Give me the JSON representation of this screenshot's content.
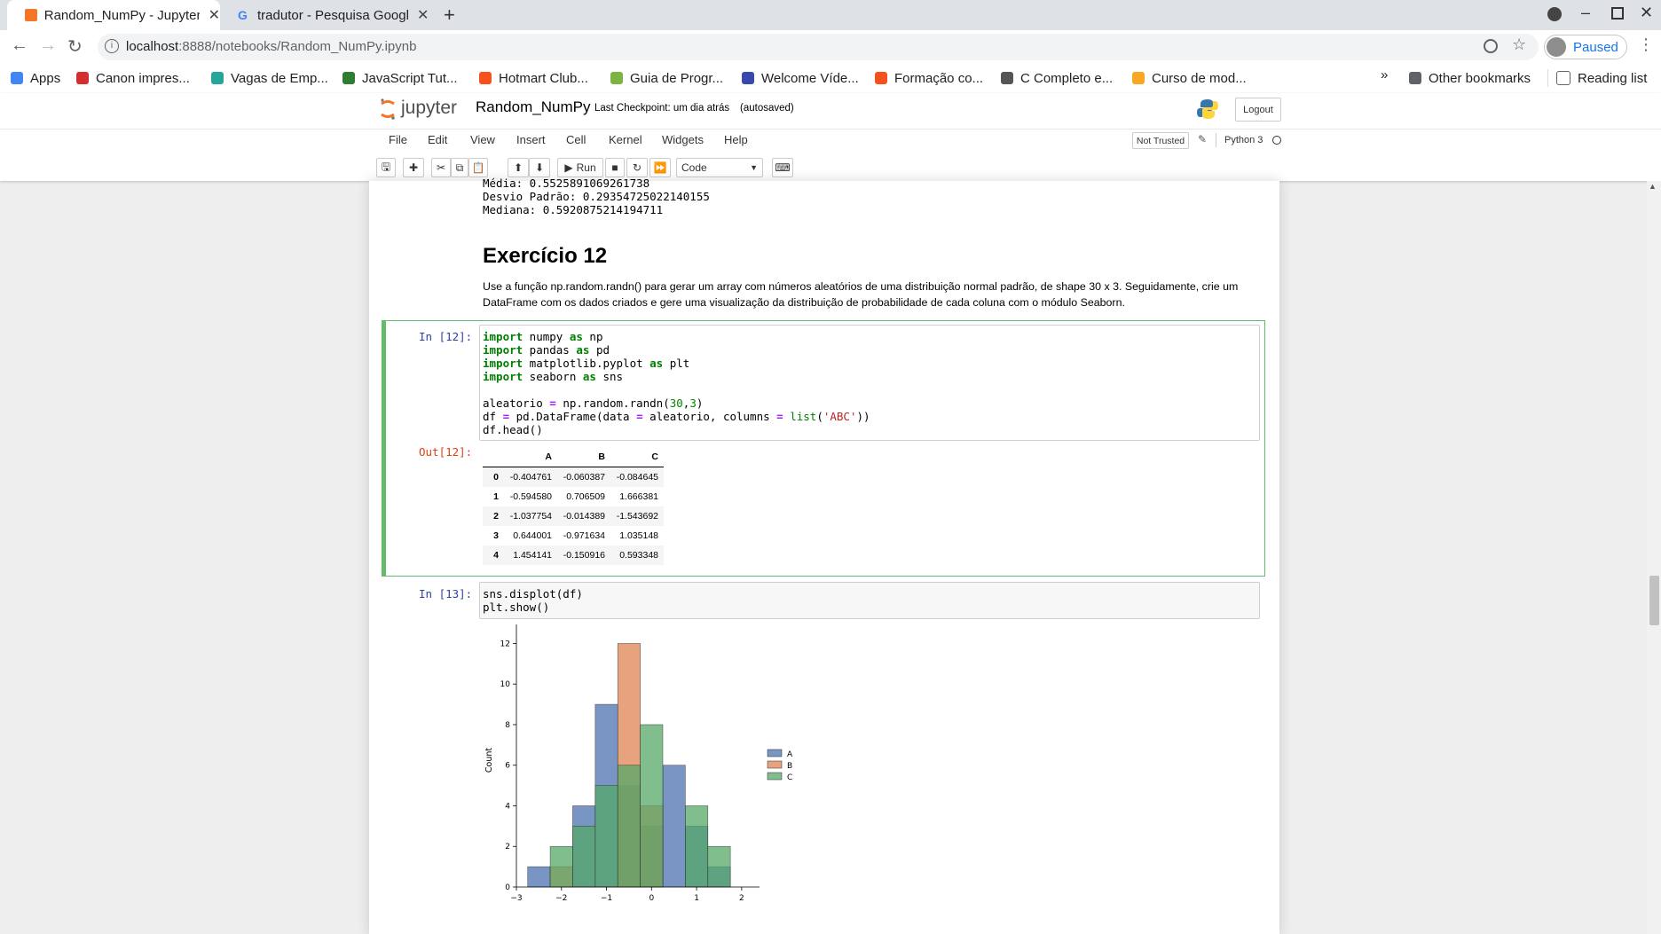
{
  "browser": {
    "tabs": [
      {
        "title": "Random_NumPy - Jupyter Notebook",
        "active": true
      },
      {
        "title": "tradutor - Pesquisa Google",
        "active": false
      }
    ],
    "url_host": "localhost",
    "url_path": ":8888/notebooks/Random_NumPy.ipynb",
    "profile_label": "Paused",
    "bookmarks": [
      {
        "label": "Apps",
        "icon": "apps-grid-icon",
        "color": "#4285f4"
      },
      {
        "label": "Canon impres...",
        "icon": "canon-icon",
        "color": "#d32f2f"
      },
      {
        "label": "Vagas de Emp...",
        "icon": "vagas-icon",
        "color": "#26a69a"
      },
      {
        "label": "JavaScript Tut...",
        "icon": "w3schools-icon",
        "color": "#2e7d32"
      },
      {
        "label": "Hotmart Club...",
        "icon": "hotmart-icon",
        "color": "#f4511e"
      },
      {
        "label": "Guia de Progr...",
        "icon": "microsoft-icon",
        "color": "#7cb342"
      },
      {
        "label": "Welcome Víde...",
        "icon": "c-icon",
        "color": "#3949ab"
      },
      {
        "label": "Formação co...",
        "icon": "hotmart-icon",
        "color": "#f4511e"
      },
      {
        "label": "C Completo e...",
        "icon": "c-icon",
        "color": "#555555"
      },
      {
        "label": "Curso de mod...",
        "icon": "folder-icon",
        "color": "#f9a825"
      }
    ],
    "other_bookmarks": "Other bookmarks",
    "reading_list": "Reading list",
    "more": "»"
  },
  "jupyter": {
    "logo_text": "jupyter",
    "notebook_name": "Random_NumPy",
    "checkpoint": "Last Checkpoint: um dia atrás",
    "autosave": "(autosaved)",
    "logout": "Logout",
    "menus": [
      "File",
      "Edit",
      "View",
      "Insert",
      "Cell",
      "Kernel",
      "Widgets",
      "Help"
    ],
    "trust": "Not Trusted",
    "kernel": "Python 3",
    "run_label": "Run",
    "cell_type": "Code"
  },
  "notebook": {
    "prev_output": [
      "Média: 0.5525891069261738",
      "Desvio Padrão: 0.29354725022140155",
      "Mediana: 0.5920875214194711"
    ],
    "heading": "Exercício 12",
    "description": "Use a função np.random.randn() para gerar um array com números aleatórios de uma distribuição normal padrão, de shape 30 x 3. Seguidamente, crie um DataFrame com os dados criados e gere uma visualização da distribuição de probabilidade de cada coluna com o módulo Seaborn.",
    "cell12_prompt": "In [12]:",
    "cell12_out_prompt": "Out[12]:",
    "cell13_prompt": "In [13]:",
    "cell13_code": [
      "sns.displot(df)",
      "plt.show()"
    ],
    "df_columns": [
      "A",
      "B",
      "C"
    ],
    "df_rows": [
      [
        "0",
        "-0.404761",
        "-0.060387",
        "-0.084645"
      ],
      [
        "1",
        "-0.594580",
        "0.706509",
        "1.666381"
      ],
      [
        "2",
        "-1.037754",
        "-0.014389",
        "-1.543692"
      ],
      [
        "3",
        "0.644001",
        "-0.971634",
        "1.035148"
      ],
      [
        "4",
        "1.454141",
        "-0.150916",
        "0.593348"
      ]
    ]
  },
  "chart_data": {
    "type": "bar",
    "ylabel": "Count",
    "xlabel": "",
    "xlim": [
      -3,
      2.2
    ],
    "ylim": [
      0,
      12.5
    ],
    "xticks": [
      "−3",
      "−2",
      "−1",
      "0",
      "1",
      "2"
    ],
    "yticks": [
      "0",
      "2",
      "4",
      "6",
      "8",
      "10",
      "12"
    ],
    "bin_edges": [
      -2.75,
      -2.25,
      -1.75,
      -1.25,
      -0.75,
      -0.25,
      0.25,
      0.75,
      1.25,
      1.75
    ],
    "legend_position": "right",
    "series": [
      {
        "name": "A",
        "color": "#4c72b0",
        "values": [
          1,
          0,
          4,
          9,
          5,
          3,
          6,
          3,
          1
        ]
      },
      {
        "name": "B",
        "color": "#dd8452",
        "values": [
          0,
          1,
          0,
          0,
          12,
          4,
          0,
          0,
          0
        ]
      },
      {
        "name": "C",
        "color": "#55a868",
        "values": [
          0,
          2,
          3,
          5,
          6,
          8,
          0,
          4,
          2
        ]
      }
    ]
  }
}
